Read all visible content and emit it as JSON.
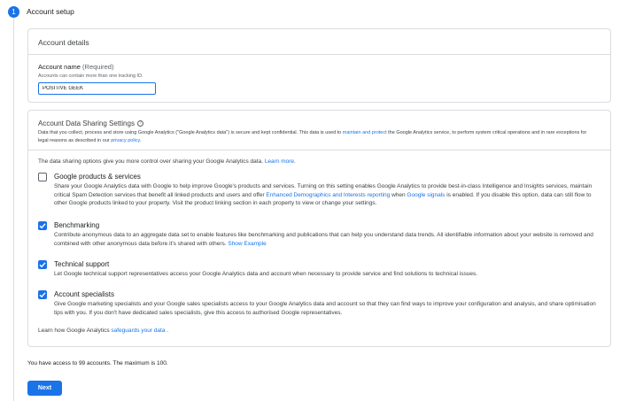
{
  "step": {
    "number": "1",
    "title": "Account setup"
  },
  "account_details": {
    "heading": "Account details",
    "name_label": "Account name",
    "name_required": "(Required)",
    "name_hint": "Accounts can contain more than one tracking ID.",
    "name_value": "POSITIVE GEEK"
  },
  "sharing": {
    "heading": "Account Data Sharing Settings",
    "desc_pre": "Data that you collect, process and store using Google Analytics (\"Google Analytics data\") is secure and kept confidential. This data is used to ",
    "desc_link1": "maintain and protect",
    "desc_mid": " the Google Analytics service, to perform system critical operations and in rare exceptions for legal reasons as described in our ",
    "desc_link2": "privacy policy",
    "desc_end": ".",
    "intro_text": "The data sharing options give you more control over sharing your Google Analytics data. ",
    "intro_link": "Learn more.",
    "options": [
      {
        "title": "Google products & services",
        "checked": false,
        "desc_pre": "Share your Google Analytics data with Google to help improve Google's products and services. Turning on this setting enables Google Analytics to provide best-in-class Intelligence and Insights services, maintain critical Spam Detection services that benefit all linked products and users and offer ",
        "desc_link1": "Enhanced Demographics and Interests reporting",
        "desc_mid": " when ",
        "desc_link2": "Google signals",
        "desc_end": " is enabled. If you disable this option, data can still flow to other Google products linked to your property. Visit the product linking section in each property to view or change your settings."
      },
      {
        "title": "Benchmarking",
        "checked": true,
        "desc_pre": "Contribute anonymous data to an aggregate data set to enable features like benchmarking and publications that can help you understand data trends. All identifiable information about your website is removed and combined with other anonymous data before it's shared with others.  ",
        "desc_link1": "Show Example"
      },
      {
        "title": "Technical support",
        "checked": true,
        "desc_pre": "Let Google technical support representatives access your Google Analytics data and account when necessary to provide service and find solutions to technical issues."
      },
      {
        "title": "Account specialists",
        "checked": true,
        "desc_pre": "Give Google marketing specialists and your Google sales specialists access to your Google Analytics data and account so that they can find ways to improve your configuration and analysis, and share optimisation tips with you. If you don't have dedicated sales specialists, give this access to authorised Google representatives."
      }
    ],
    "learn_pre": "Learn how Google Analytics ",
    "learn_link": "safeguards your data",
    "learn_end": " ."
  },
  "access_text": "You have access to 99 accounts. The maximum is 100.",
  "next_label": "Next",
  "colors": {
    "accent": "#1a73e8",
    "border": "#dadce0"
  }
}
